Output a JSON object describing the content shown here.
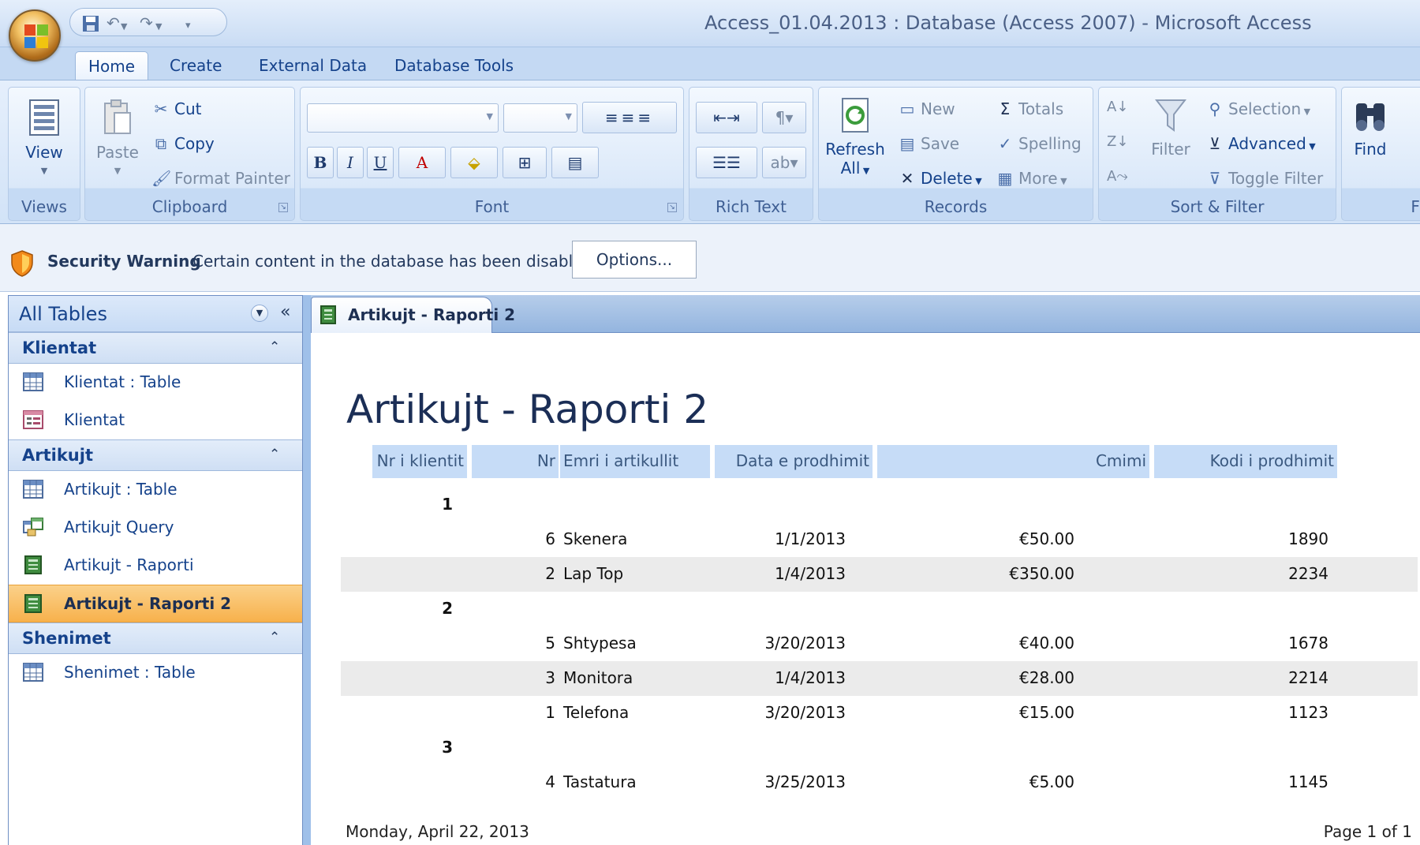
{
  "window": {
    "title": "Access_01.04.2013 : Database (Access 2007) - Microsoft Access"
  },
  "quick_access": {
    "icons": [
      "save-icon",
      "undo-icon",
      "redo-icon",
      "customize-qat-icon"
    ]
  },
  "ribbon_tabs": [
    "Home",
    "Create",
    "External Data",
    "Database Tools"
  ],
  "ribbon": {
    "views": {
      "label": "Views",
      "view": "View"
    },
    "clipboard": {
      "label": "Clipboard",
      "paste": "Paste",
      "cut": "Cut",
      "copy": "Copy",
      "format_painter": "Format Painter"
    },
    "font": {
      "label": "Font",
      "bold": "B",
      "italic": "I",
      "underline": "U",
      "font_color": "A"
    },
    "rich_text": {
      "label": "Rich Text"
    },
    "records": {
      "label": "Records",
      "refresh": "Refresh",
      "refresh_all": "All",
      "new": "New",
      "save": "Save",
      "delete": "Delete",
      "totals": "Totals",
      "spelling": "Spelling",
      "more": "More"
    },
    "sort_filter": {
      "label": "Sort & Filter",
      "filter": "Filter",
      "selection": "Selection",
      "advanced": "Advanced",
      "toggle_filter": "Toggle Filter"
    },
    "find": {
      "label": "Fi",
      "find": "Find"
    }
  },
  "security_bar": {
    "title": "Security Warning",
    "message": "Certain content in the database has been disabled",
    "options": "Options..."
  },
  "nav_pane": {
    "title": "All Tables",
    "groups": [
      {
        "name": "Klientat",
        "items": [
          {
            "label": "Klientat : Table",
            "icon": "table-icon"
          },
          {
            "label": "Klientat",
            "icon": "form-icon"
          }
        ]
      },
      {
        "name": "Artikujt",
        "items": [
          {
            "label": "Artikujt : Table",
            "icon": "table-icon"
          },
          {
            "label": "Artikujt Query",
            "icon": "query-icon"
          },
          {
            "label": "Artikujt - Raporti",
            "icon": "report-icon"
          },
          {
            "label": "Artikujt - Raporti 2",
            "icon": "report-icon",
            "selected": true
          }
        ]
      },
      {
        "name": "Shenimet",
        "items": [
          {
            "label": "Shenimet : Table",
            "icon": "table-icon"
          }
        ]
      }
    ]
  },
  "document": {
    "tab": "Artikujt - Raporti 2",
    "report_title": "Artikujt - Raporti 2",
    "headers": [
      "Nr i klientit",
      "Nr",
      "Emri i artikullit",
      "Data e prodhimit",
      "Cmimi",
      "Kodi i prodhimit"
    ],
    "groups": [
      {
        "client": "1",
        "rows": [
          {
            "nr": "6",
            "name": "Skenera",
            "date": "1/1/2013",
            "price": "€50.00",
            "code": "1890"
          },
          {
            "nr": "2",
            "name": "Lap Top",
            "date": "1/4/2013",
            "price": "€350.00",
            "code": "2234"
          }
        ]
      },
      {
        "client": "2",
        "rows": [
          {
            "nr": "5",
            "name": "Shtypesa",
            "date": "3/20/2013",
            "price": "€40.00",
            "code": "1678"
          },
          {
            "nr": "3",
            "name": "Monitora",
            "date": "1/4/2013",
            "price": "€28.00",
            "code": "2214"
          },
          {
            "nr": "1",
            "name": "Telefona",
            "date": "3/20/2013",
            "price": "€15.00",
            "code": "1123"
          }
        ]
      },
      {
        "client": "3",
        "rows": [
          {
            "nr": "4",
            "name": "Tastatura",
            "date": "3/25/2013",
            "price": "€5.00",
            "code": "1145"
          }
        ]
      }
    ],
    "footer_date": "Monday, April 22, 2013",
    "footer_page": "Page 1 of 1"
  },
  "colors": {
    "ribbon": "#dae8f9",
    "selected_nav": "#f7b14c",
    "header_fill": "#c6dcf7",
    "alt_row": "#ebebeb"
  }
}
